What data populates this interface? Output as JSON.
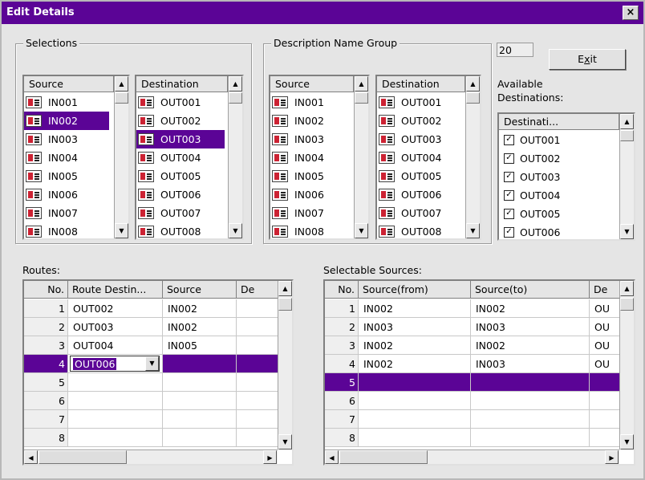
{
  "window": {
    "title": "Edit Details",
    "close_glyph": "×"
  },
  "selections": {
    "label": "Selections",
    "source": {
      "header": "Source",
      "items": [
        "IN001",
        "IN002",
        "IN003",
        "IN004",
        "IN005",
        "IN006",
        "IN007",
        "IN008"
      ],
      "selected": "IN002"
    },
    "destination": {
      "header": "Destination",
      "items": [
        "OUT001",
        "OUT002",
        "OUT003",
        "OUT004",
        "OUT005",
        "OUT006",
        "OUT007",
        "OUT008"
      ],
      "selected": "OUT003"
    }
  },
  "description_group": {
    "label": "Description Name Group",
    "source": {
      "header": "Source",
      "items": [
        "IN001",
        "IN002",
        "IN003",
        "IN004",
        "IN005",
        "IN006",
        "IN007",
        "IN008"
      ]
    },
    "destination": {
      "header": "Destination",
      "items": [
        "OUT001",
        "OUT002",
        "OUT003",
        "OUT004",
        "OUT005",
        "OUT006",
        "OUT007",
        "OUT008"
      ]
    }
  },
  "count_value": "20",
  "exit_button": {
    "pre": "E",
    "key": "x",
    "post": "it"
  },
  "available_destinations": {
    "label_line1": "Available",
    "label_line2": "Destinations:",
    "header": "Destinati...",
    "items": [
      "OUT001",
      "OUT002",
      "OUT003",
      "OUT004",
      "OUT005",
      "OUT006"
    ],
    "check_glyph": "✓"
  },
  "routes": {
    "label": "Routes:",
    "columns": [
      "No.",
      "Route Destin...",
      "Source",
      "De"
    ],
    "rows": [
      {
        "no": "1",
        "dest": "OUT002",
        "src": "IN002"
      },
      {
        "no": "2",
        "dest": "OUT003",
        "src": "IN002"
      },
      {
        "no": "3",
        "dest": "OUT004",
        "src": "IN005"
      },
      {
        "no": "4",
        "dest": "OUT006",
        "src": ""
      },
      {
        "no": "5",
        "dest": "",
        "src": ""
      },
      {
        "no": "6",
        "dest": "",
        "src": ""
      },
      {
        "no": "7",
        "dest": "",
        "src": ""
      },
      {
        "no": "8",
        "dest": "",
        "src": ""
      }
    ],
    "editing_row": 3
  },
  "selectable_sources": {
    "label": "Selectable Sources:",
    "columns": [
      "No.",
      "Source(from)",
      "Source(to)",
      "De"
    ],
    "rows": [
      {
        "no": "1",
        "from": "IN002",
        "to": "IN002",
        "de": "OU"
      },
      {
        "no": "2",
        "from": "IN003",
        "to": "IN003",
        "de": "OU"
      },
      {
        "no": "3",
        "from": "IN002",
        "to": "IN002",
        "de": "OU"
      },
      {
        "no": "4",
        "from": "IN002",
        "to": "IN003",
        "de": "OU"
      },
      {
        "no": "5",
        "from": "",
        "to": "",
        "de": ""
      },
      {
        "no": "6",
        "from": "",
        "to": "",
        "de": ""
      },
      {
        "no": "7",
        "from": "",
        "to": "",
        "de": ""
      },
      {
        "no": "8",
        "from": "",
        "to": "",
        "de": ""
      }
    ],
    "selected_row": 4
  },
  "glyphs": {
    "up": "▲",
    "down": "▼",
    "left": "◀",
    "right": "▶",
    "combo": "▼"
  },
  "colors": {
    "accent": "#5b0496",
    "window_bg": "#e5e5e5"
  }
}
